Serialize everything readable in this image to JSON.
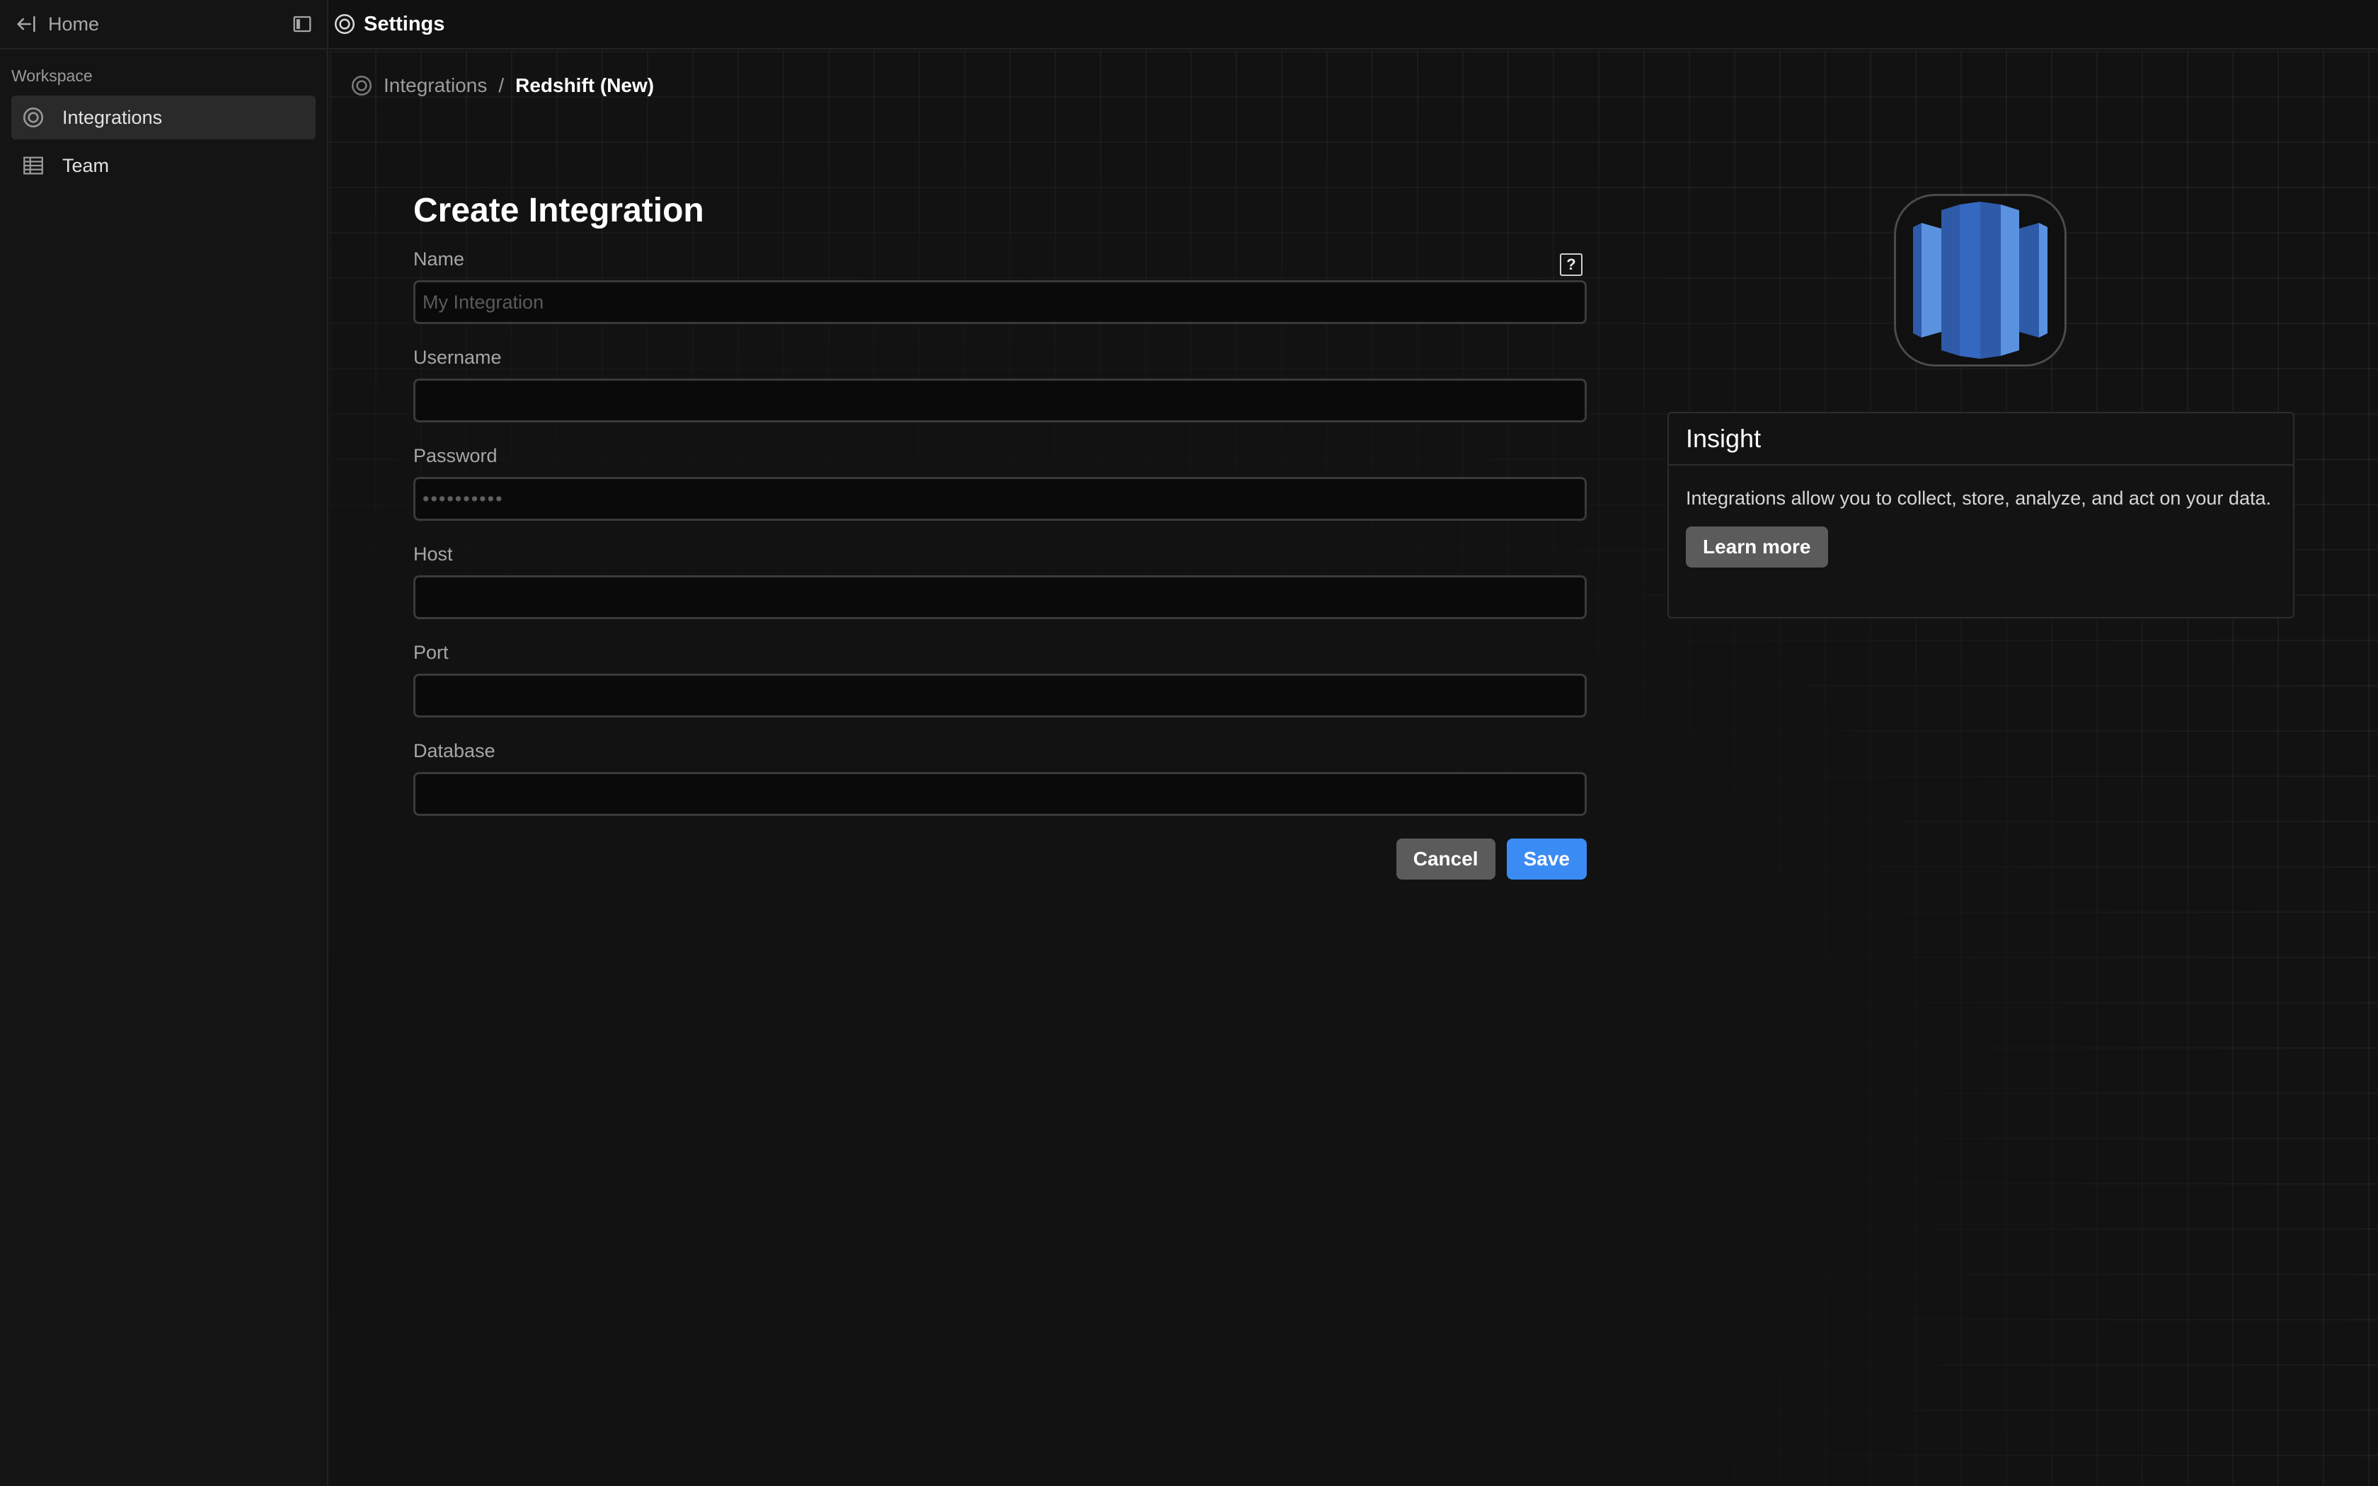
{
  "sidebar": {
    "back_label": "Home",
    "section_label": "Workspace",
    "items": [
      {
        "label": "Integrations",
        "icon": "integrations-icon",
        "active": true
      },
      {
        "label": "Team",
        "icon": "team-icon",
        "active": false
      }
    ]
  },
  "header": {
    "title": "Settings",
    "icon": "settings-icon"
  },
  "breadcrumb": {
    "parent": "Integrations",
    "separator": "/",
    "current": "Redshift (New)"
  },
  "form": {
    "title": "Create Integration",
    "fields": {
      "name": {
        "label": "Name",
        "placeholder": "My Integration",
        "value": ""
      },
      "username": {
        "label": "Username",
        "placeholder": "",
        "value": ""
      },
      "password": {
        "label": "Password",
        "placeholder": "••••••••••",
        "value": ""
      },
      "host": {
        "label": "Host",
        "placeholder": "",
        "value": ""
      },
      "port": {
        "label": "Port",
        "placeholder": "",
        "value": ""
      },
      "database": {
        "label": "Database",
        "placeholder": "",
        "value": ""
      }
    },
    "help_icon": "?",
    "cancel_label": "Cancel",
    "save_label": "Save"
  },
  "insight": {
    "title": "Insight",
    "text": "Integrations allow you to collect, store, analyze, and act on your data.",
    "button_label": "Learn more"
  },
  "logo": {
    "icon": "redshift-logo"
  },
  "colors": {
    "background": "#111111",
    "accent": "#3b8bf4",
    "secondary_button": "#5b5b5b",
    "logo_blue_dark": "#2e5aa8",
    "logo_blue_light": "#5a92e0"
  }
}
